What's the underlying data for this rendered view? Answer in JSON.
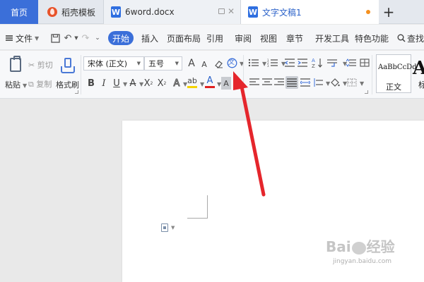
{
  "tabs": {
    "home": "首页",
    "template": "稻壳模板",
    "doc_6word": "6word.docx",
    "doc_active": "文字文稿1",
    "doc_icon_letter": "W",
    "add": "+"
  },
  "menu": {
    "file": "文件",
    "items": [
      "开始",
      "插入",
      "页面布局",
      "引用",
      "审阅",
      "视图",
      "章节",
      "开发工具",
      "特色功能"
    ],
    "search": "查找"
  },
  "ribbon": {
    "paste": "粘贴",
    "cut": "剪切",
    "copy": "复制",
    "format_painter": "格式刷",
    "font_name": "宋体 (正文)",
    "font_size": "五号",
    "grow_font": "A",
    "shrink_font": "A",
    "bold": "B",
    "italic": "I",
    "underline": "U",
    "strikethrough": "A",
    "superscript": "X",
    "subscript": "X",
    "text_effect": "A",
    "highlight": "ab",
    "font_color": "A",
    "char_shade": "A",
    "pinyin": "文",
    "style_sample": "AaBbCcDd",
    "style_name": "正文",
    "style_next_sample": "Aa",
    "style_next_name": "标"
  },
  "watermark": {
    "brand_left": "Bai",
    "brand_right": "经验",
    "url": "jingyan.baidu.com"
  },
  "colors": {
    "accent": "#3b6fd9",
    "annotation_arrow": "#e5262c",
    "highlight_yellow": "#f5d300",
    "font_color_red": "#e02020"
  }
}
